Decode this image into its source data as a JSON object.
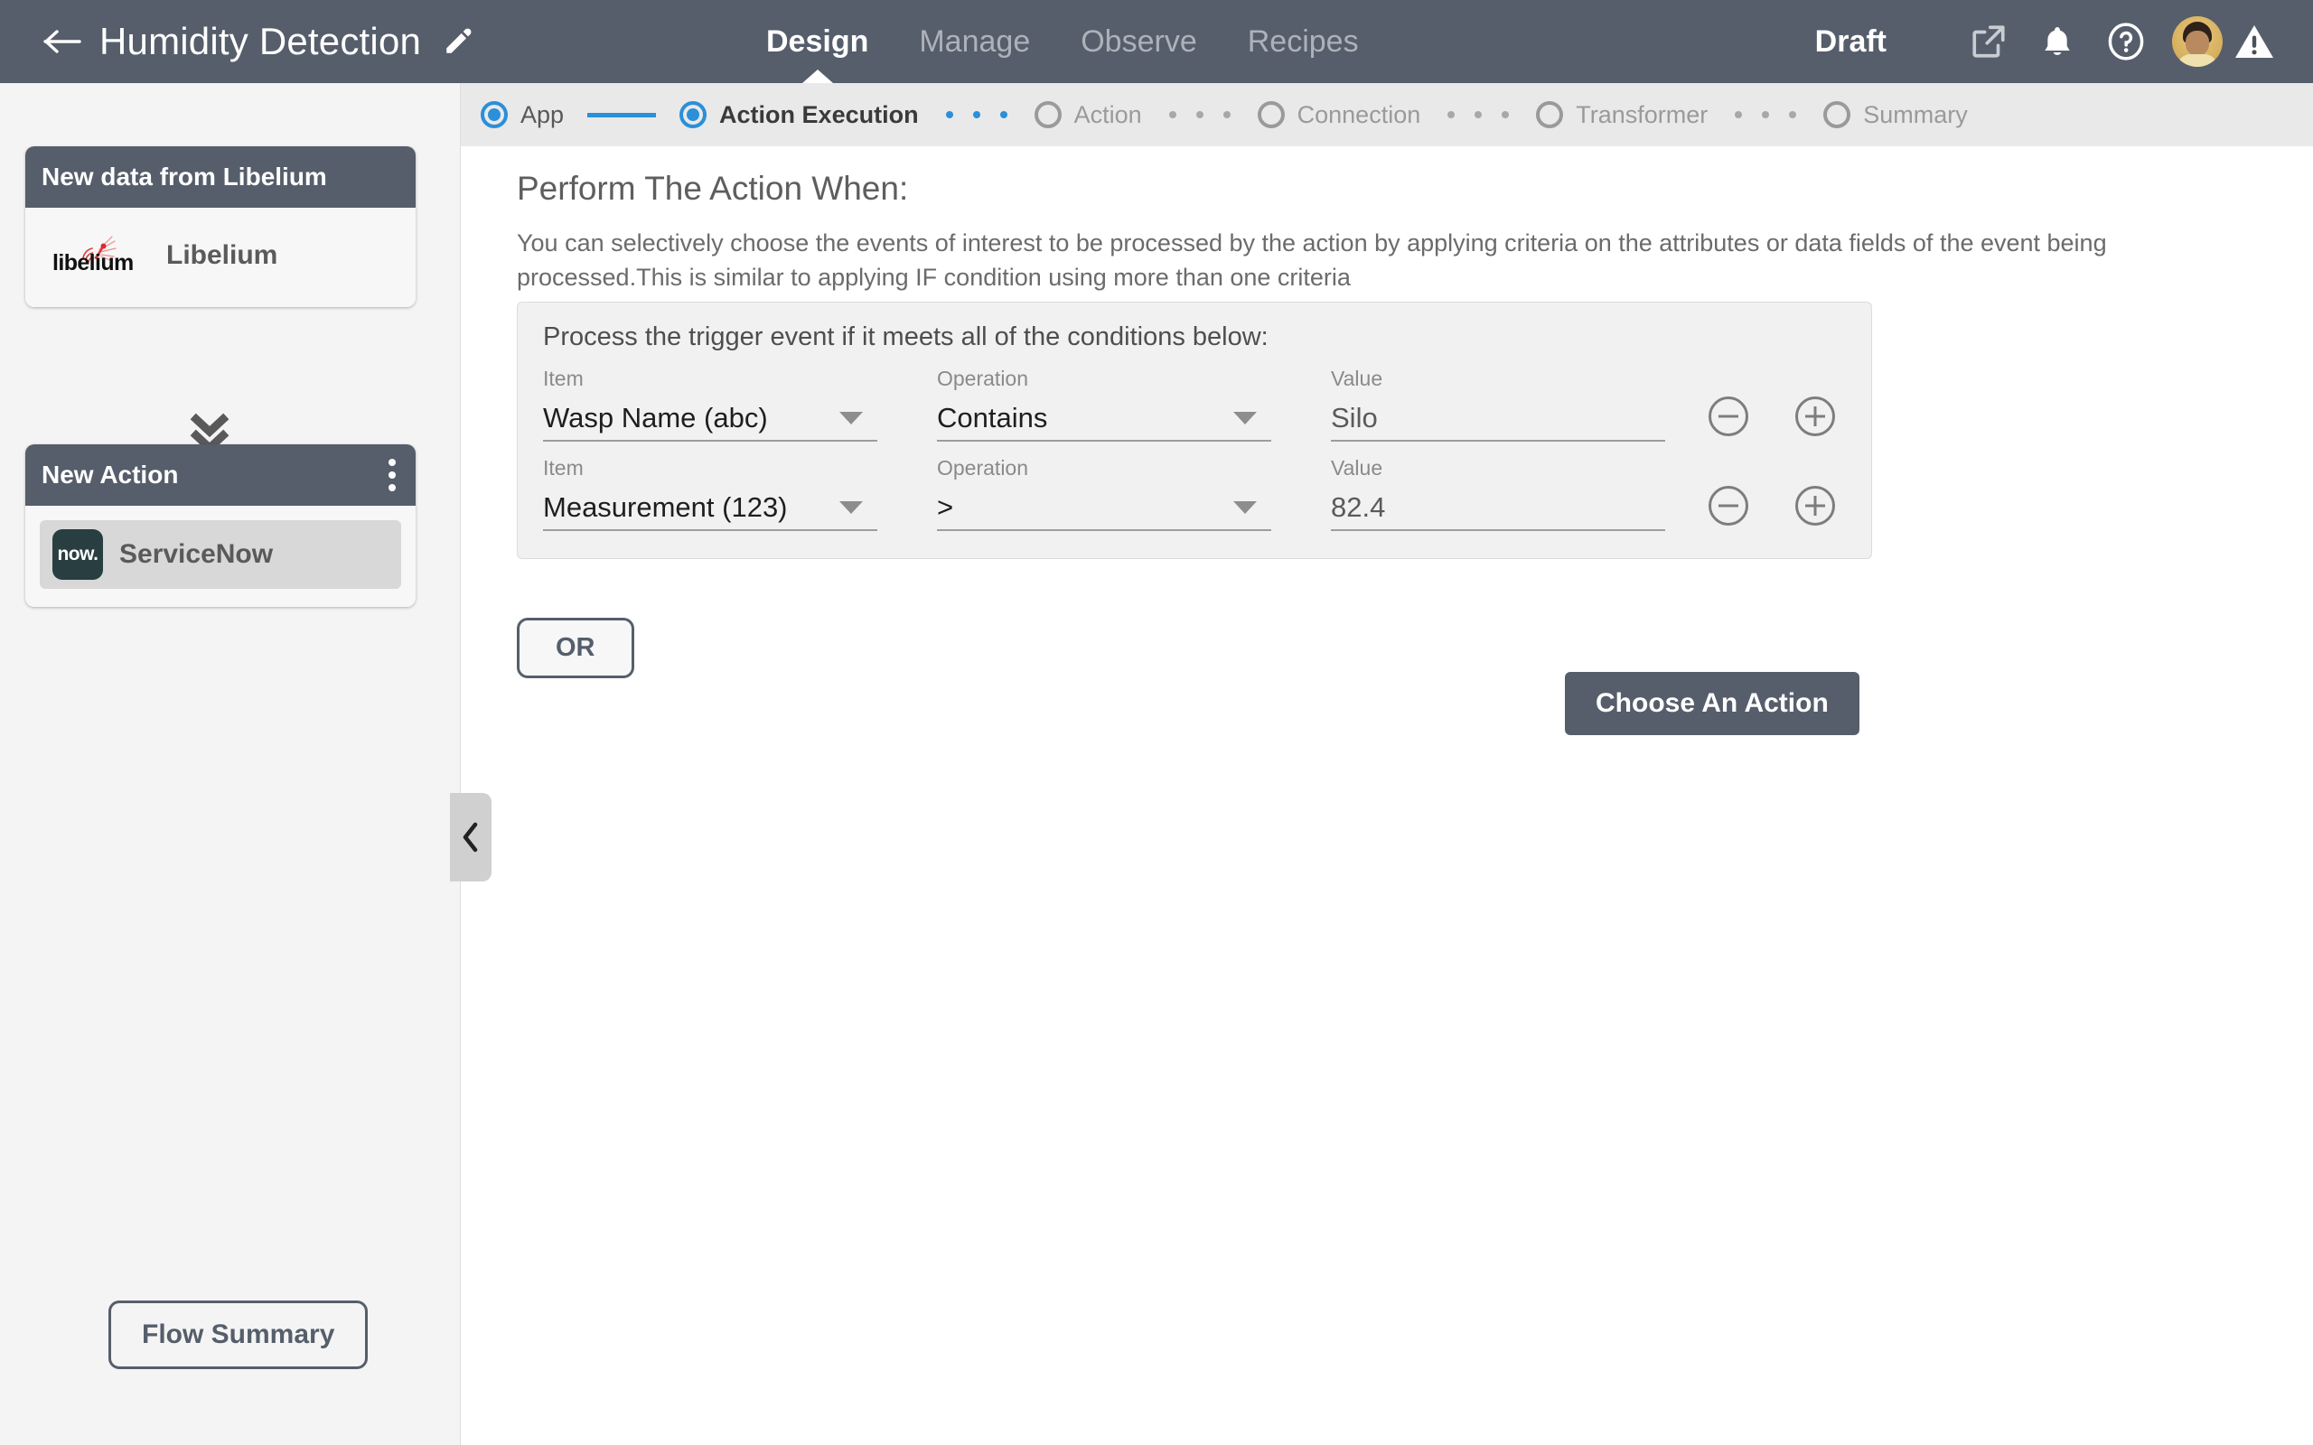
{
  "topbar": {
    "back_icon": "back-arrow-icon",
    "title": "Humidity Detection",
    "edit_icon": "pencil-icon",
    "status": "Draft",
    "tabs": [
      {
        "label": "Design",
        "active": true
      },
      {
        "label": "Manage",
        "active": false
      },
      {
        "label": "Observe",
        "active": false
      },
      {
        "label": "Recipes",
        "active": false
      }
    ],
    "icons": [
      {
        "name": "external-link-icon"
      },
      {
        "name": "bell-icon"
      },
      {
        "name": "help-icon"
      },
      {
        "name": "avatar"
      },
      {
        "name": "warning-icon"
      }
    ],
    "bg_color": "#565e6b"
  },
  "stepper": {
    "accent_color": "#2b8fd9",
    "steps": [
      {
        "label": "App",
        "state": "done"
      },
      {
        "label": "Action Execution",
        "state": "current"
      },
      {
        "label": "Action",
        "state": "pending"
      },
      {
        "label": "Connection",
        "state": "pending"
      },
      {
        "label": "Transformer",
        "state": "pending"
      },
      {
        "label": "Summary",
        "state": "pending"
      }
    ]
  },
  "sidebar": {
    "trigger_card": {
      "title": "New data from Libelium",
      "item_label": "Libelium",
      "logo_word": "libelium"
    },
    "connector_icon": "double-chevron-down-icon",
    "action_card": {
      "title": "New Action",
      "menu_icon": "kebab-menu-icon",
      "item_label": "ServiceNow",
      "logo_word": "now."
    },
    "flow_summary_label": "Flow Summary",
    "collapse_icon": "chevron-left-icon"
  },
  "main": {
    "title": "Perform The Action When:",
    "description": "You can selectively choose the events of interest to be processed by the action by applying criteria on the attributes or data fields of the event being processed.This is similar to applying IF condition using more than one criteria",
    "condition_panel": {
      "title": "Process the trigger event if it meets all of the conditions below:",
      "labels": {
        "item": "Item",
        "operation": "Operation",
        "value": "Value"
      },
      "rows": [
        {
          "item": "Wasp Name (abc)",
          "operation": "Contains",
          "value": "Silo",
          "remove_icon": "minus-circle-icon",
          "add_icon": "plus-circle-icon"
        },
        {
          "item": "Measurement (123)",
          "operation": ">",
          "value": "82.4",
          "remove_icon": "minus-circle-icon",
          "add_icon": "plus-circle-icon"
        }
      ]
    },
    "or_label": "OR",
    "choose_action_label": "Choose An Action"
  }
}
